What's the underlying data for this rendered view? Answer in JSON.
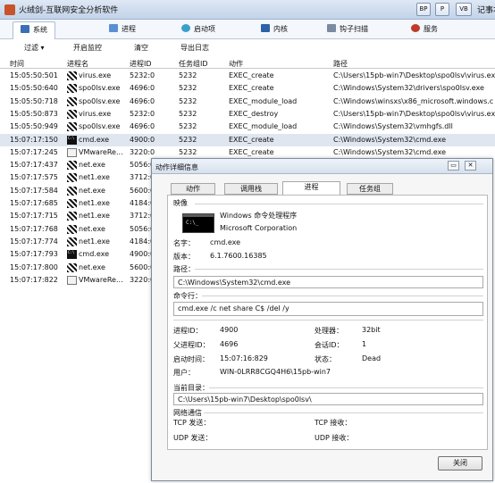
{
  "window": {
    "title": "火绒剑-互联网安全分析软件",
    "buttons": [
      "BP",
      "P",
      "VB"
    ],
    "notes_label": "记事本"
  },
  "tabs": [
    "系统",
    "进程",
    "启动项",
    "内核",
    "钩子扫描",
    "服务"
  ],
  "toolbar": {
    "filter": "过滤",
    "monitor": "开启监控",
    "clear": "清空",
    "export": "导出日志"
  },
  "table": {
    "headers": [
      "时间",
      "进程名",
      "进程ID",
      "任务组ID",
      "动作",
      "路径"
    ],
    "rows": [
      [
        "15:05:50:501",
        "virus.exe",
        "5232:0",
        "5232",
        "EXEC_create",
        "C:\\Users\\15pb-win7\\Desktop\\spo0lsv\\virus.exe"
      ],
      [
        "15:05:50:640",
        "spo0lsv.exe",
        "4696:0",
        "5232",
        "EXEC_create",
        "C:\\Windows\\System32\\drivers\\spo0lsv.exe"
      ],
      [
        "15:05:50:718",
        "spo0lsv.exe",
        "4696:0",
        "5232",
        "EXEC_module_load",
        "C:\\Windows\\winsxs\\x86_microsoft.windows.c"
      ],
      [
        "15:05:50:873",
        "virus.exe",
        "5232:0",
        "5232",
        "EXEC_destroy",
        "C:\\Users\\15pb-win7\\Desktop\\spo0lsv\\virus.exe"
      ],
      [
        "15:05:50:949",
        "spo0lsv.exe",
        "4696:0",
        "5232",
        "EXEC_module_load",
        "C:\\Windows\\System32\\vmhgfs.dll"
      ],
      [
        "15:07:17:150",
        "cmd.exe",
        "4900:0",
        "5232",
        "EXEC_create",
        "C:\\Windows\\System32\\cmd.exe"
      ],
      [
        "15:07:17:245",
        "VMwareRe...",
        "3220:0",
        "5232",
        "EXEC_create",
        "C:\\Windows\\System32\\cmd.exe"
      ],
      [
        "15:07:17:437",
        "net.exe",
        "5056:0",
        "",
        "",
        ""
      ],
      [
        "15:07:17:575",
        "net1.exe",
        "3712:0",
        "",
        "",
        ""
      ],
      [
        "15:07:17:584",
        "net.exe",
        "5600:0",
        "",
        "",
        ""
      ],
      [
        "15:07:17:685",
        "net1.exe",
        "4184:0",
        "",
        "",
        ""
      ],
      [
        "15:07:17:715",
        "net1.exe",
        "3712:0",
        "",
        "",
        ""
      ],
      [
        "15:07:17:768",
        "net.exe",
        "5056:0",
        "",
        "",
        ""
      ],
      [
        "15:07:17:774",
        "net1.exe",
        "4184:0",
        "",
        "",
        ""
      ],
      [
        "15:07:17:793",
        "cmd.exe",
        "4900:0",
        "",
        "",
        ""
      ],
      [
        "15:07:17:800",
        "net.exe",
        "5600:0",
        "",
        "",
        ""
      ],
      [
        "15:07:17:822",
        "VMwareRe...",
        "3220:0",
        "",
        "",
        ""
      ]
    ]
  },
  "dialog": {
    "title": "动作详细信息",
    "tabs": [
      "动作",
      "调用栈",
      "进程",
      "任务组"
    ],
    "image_label": "映像",
    "desc": "Windows 命令处理程序",
    "company": "Microsoft Corporation",
    "name_label": "名字：",
    "name": "cmd.exe",
    "version_label": "版本：",
    "version": "6.1.7600.16385",
    "path_label": "路径：",
    "path": "C:\\Windows\\System32\\cmd.exe",
    "cmdline_label": "命令行：",
    "cmdline": "cmd.exe /c net share C$ /del /y",
    "pid_label": "进程ID：",
    "pid": "4900",
    "cpu_label": "处理器：",
    "cpu": "32bit",
    "ppid_label": "父进程ID：",
    "ppid": "4696",
    "session_label": "会话ID：",
    "session": "1",
    "start_label": "启动时间：",
    "start": "15:07:16:829",
    "state_label": "状态：",
    "state": "Dead",
    "user_label": "用户：",
    "user": "WIN-0LRR8CGQ4H6\\15pb-win7",
    "cwd_label": "当前目录：",
    "cwd": "C:\\Users\\15pb-win7\\Desktop\\spo0lsv\\",
    "net_label": "网络通信",
    "tcp_send_label": "TCP 发送：",
    "tcp_recv_label": "TCP 接收：",
    "udp_send_label": "UDP 发送：",
    "udp_recv_label": "UDP 接收：",
    "close_label": "关闭"
  },
  "icons": [
    "app-icon",
    "system-tab-icon",
    "process-tab-icon",
    "startup-tab-icon",
    "kernel-tab-icon",
    "hook-tab-icon",
    "service-tab-icon",
    "cmd-icon",
    "virus-icon",
    "vmware-icon"
  ]
}
